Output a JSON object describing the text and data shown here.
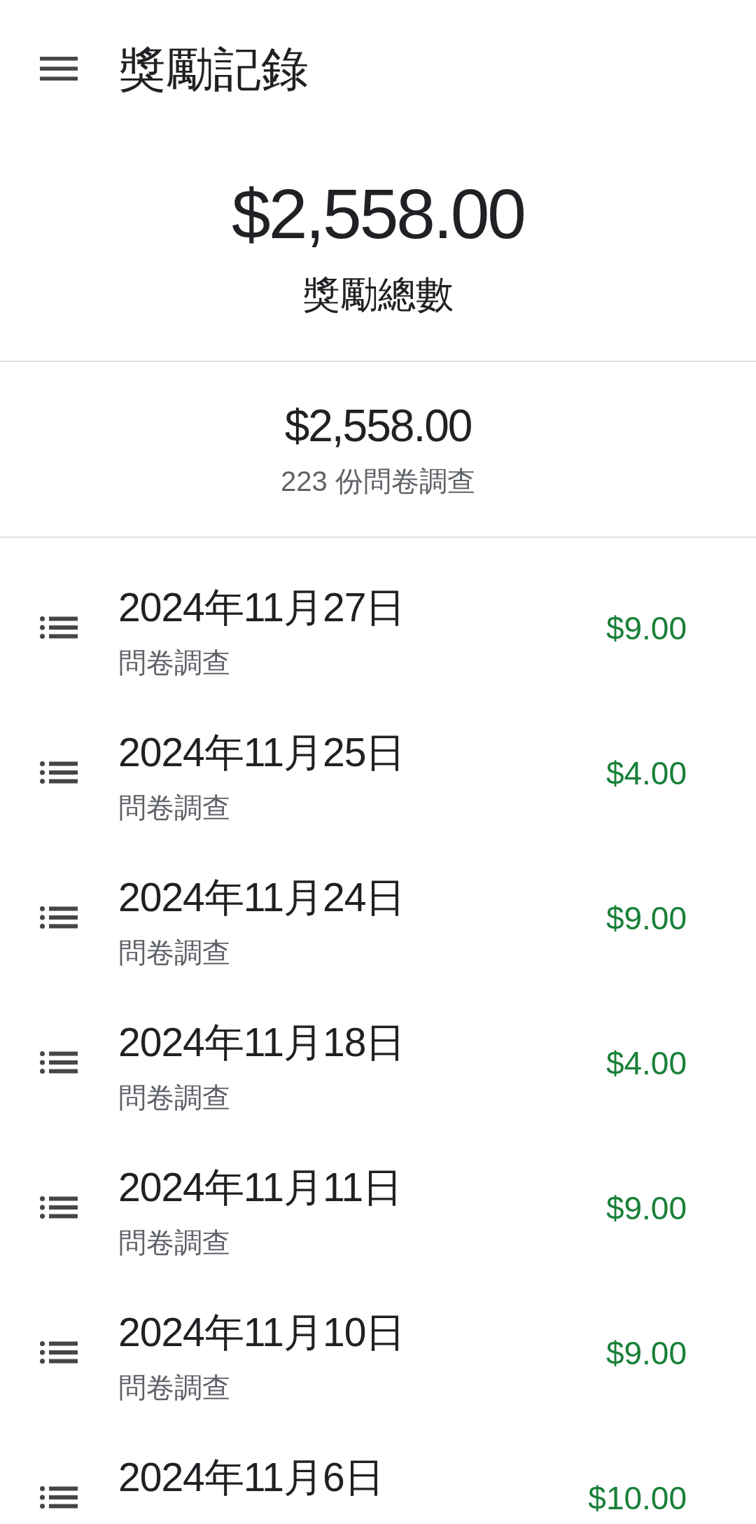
{
  "app_bar": {
    "title": "獎勵記錄"
  },
  "summary": {
    "total_amount": "$2,558.00",
    "total_label": "獎勵總數"
  },
  "survey_summary": {
    "amount": "$2,558.00",
    "count_label": "223 份問卷調查"
  },
  "rewards": [
    {
      "date": "2024年11月27日",
      "type": "問卷調查",
      "amount": "$9.00"
    },
    {
      "date": "2024年11月25日",
      "type": "問卷調查",
      "amount": "$4.00"
    },
    {
      "date": "2024年11月24日",
      "type": "問卷調查",
      "amount": "$9.00"
    },
    {
      "date": "2024年11月18日",
      "type": "問卷調查",
      "amount": "$4.00"
    },
    {
      "date": "2024年11月11日",
      "type": "問卷調查",
      "amount": "$9.00"
    },
    {
      "date": "2024年11月10日",
      "type": "問卷調查",
      "amount": "$9.00"
    },
    {
      "date": "2024年11月6日",
      "amount": "$10.00"
    }
  ]
}
